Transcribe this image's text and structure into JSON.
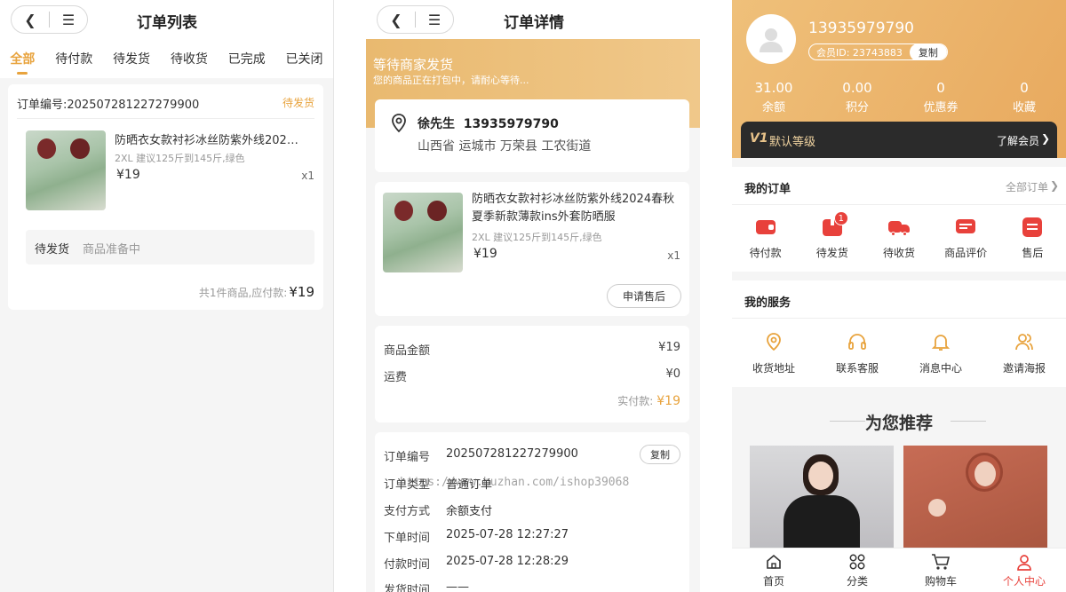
{
  "order_list": {
    "title": "订单列表",
    "tabs": [
      "全部",
      "待付款",
      "待发货",
      "待收货",
      "已完成",
      "已关闭"
    ],
    "order_no_label": "订单编号:202507281227279900",
    "status": "待发货",
    "product_name": "防晒衣女款衬衫冰丝防紫外线202…",
    "sku": "2XL 建议125斤到145斤,绿色",
    "price": "¥19",
    "qty": "x1",
    "progress_title": "待发货",
    "progress_text": "商品准备中",
    "summary_text": "共1件商品,应付款:",
    "summary_amount": "¥19"
  },
  "order_detail": {
    "title": "订单详情",
    "banner_title": "等待商家发货",
    "banner_sub": "您的商品正在打包中，请耐心等待...",
    "receiver": "徐先生  13935979790",
    "address": "山西省 运城市 万荣县 工农街道",
    "product_name": "防晒衣女款衬衫冰丝防紫外线2024春秋夏季新款薄款ins外套防晒服",
    "sku": "2XL 建议125斤到145斤,绿色",
    "price": "¥19",
    "qty": "x1",
    "after_sale_button": "申请售后",
    "goods_amount_label": "商品金额",
    "goods_amount": "¥19",
    "freight_label": "运费",
    "freight": "¥0",
    "paid_label": "实付款:",
    "paid_amount": "¥19",
    "info": [
      {
        "label": "订单编号",
        "value": "202507281227279900"
      },
      {
        "label": "订单类型",
        "value": "普通订单"
      },
      {
        "label": "支付方式",
        "value": "余额支付"
      },
      {
        "label": "下单时间",
        "value": "2025-07-28 12:27:27"
      },
      {
        "label": "付款时间",
        "value": "2025-07-28 12:28:29"
      },
      {
        "label": "发货时间",
        "value": "——"
      }
    ],
    "copy_button": "复制",
    "watermark": "https://www.huzhan.com/ishop39068"
  },
  "profile": {
    "phone": "13935979790",
    "member_id": "会员ID: 23743883",
    "copy_button": "复制",
    "stats": [
      {
        "value": "31.00",
        "label": "余额"
      },
      {
        "value": "0.00",
        "label": "积分"
      },
      {
        "value": "0",
        "label": "优惠券"
      },
      {
        "value": "0",
        "label": "收藏"
      }
    ],
    "level_badge": "V1",
    "level_text": "默认等级",
    "learn_more": "了解会员",
    "my_orders": "我的订单",
    "all_orders": "全部订单",
    "order_icons": [
      {
        "label": "待付款",
        "icon": "wallet-icon"
      },
      {
        "label": "待发货",
        "icon": "box-icon",
        "badge": "1"
      },
      {
        "label": "待收货",
        "icon": "truck-icon"
      },
      {
        "label": "商品评价",
        "icon": "comment-icon"
      },
      {
        "label": "售后",
        "icon": "exchange-icon"
      }
    ],
    "my_services": "我的服务",
    "services": [
      {
        "label": "收货地址",
        "icon": "location-icon"
      },
      {
        "label": "联系客服",
        "icon": "headset-icon"
      },
      {
        "label": "消息中心",
        "icon": "bell-icon"
      },
      {
        "label": "邀请海报",
        "icon": "users-icon"
      }
    ],
    "recommend_title": "为您推荐",
    "nav": [
      {
        "label": "首页",
        "icon": "home-icon"
      },
      {
        "label": "分类",
        "icon": "category-icon"
      },
      {
        "label": "购物车",
        "icon": "cart-icon"
      },
      {
        "label": "个人中心",
        "icon": "user-icon"
      }
    ],
    "accent": "#e8a33d",
    "red": "#e8413b"
  }
}
